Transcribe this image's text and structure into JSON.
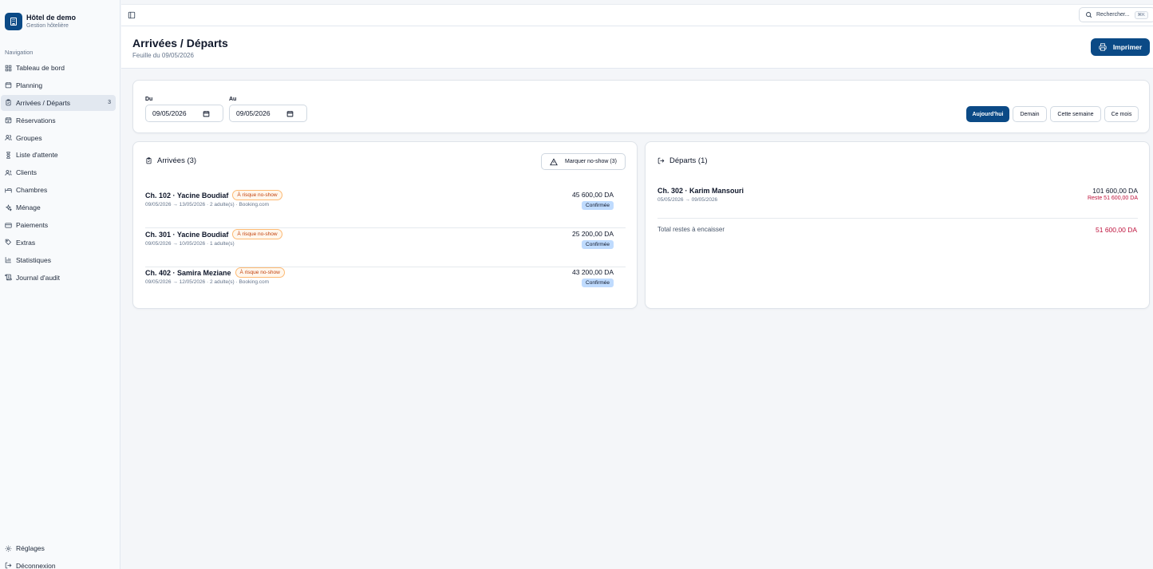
{
  "brand": {
    "name": "Hôtel de demo",
    "subtitle": "Gestion hôtelière"
  },
  "sidebar": {
    "section_label": "Navigation",
    "items": [
      {
        "label": "Tableau de bord",
        "icon": "dashboard-icon"
      },
      {
        "label": "Planning",
        "icon": "calendar-icon"
      },
      {
        "label": "Arrivées / Départs",
        "icon": "clipboard-icon",
        "badge": "3",
        "active": true
      },
      {
        "label": "Réservations",
        "icon": "calendar-check-icon"
      },
      {
        "label": "Groupes",
        "icon": "users-icon"
      },
      {
        "label": "Liste d'attente",
        "icon": "hourglass-icon"
      },
      {
        "label": "Clients",
        "icon": "user-group-icon"
      },
      {
        "label": "Chambres",
        "icon": "bed-icon"
      },
      {
        "label": "Ménage",
        "icon": "sparkles-icon"
      },
      {
        "label": "Paiements",
        "icon": "credit-card-icon"
      },
      {
        "label": "Extras",
        "icon": "tag-icon"
      },
      {
        "label": "Statistiques",
        "icon": "bar-chart-icon"
      },
      {
        "label": "Journal d'audit",
        "icon": "scroll-icon"
      }
    ],
    "bottom": [
      {
        "label": "Réglages",
        "icon": "gear-icon"
      },
      {
        "label": "Déconnexion",
        "icon": "logout-icon"
      }
    ]
  },
  "topbar": {
    "search_label": "Rechercher...",
    "search_shortcut": "⌘K"
  },
  "header": {
    "title": "Arrivées / Départs",
    "subtitle": "Feuille du 09/05/2026",
    "print_label": "Imprimer"
  },
  "filters": {
    "from_label": "Du",
    "from_value": "09/05/2026",
    "to_label": "Au",
    "to_value": "09/05/2026",
    "quick": [
      "Aujourd'hui",
      "Demain",
      "Cette semaine",
      "Ce mois"
    ],
    "active_quick": "Aujourd'hui"
  },
  "arrivals": {
    "title": "Arrivées (3)",
    "noshow_label": "Marquer no-show (3)",
    "rows": [
      {
        "title": "Ch. 102 · Yacine Boudiaf",
        "risk": "À risque no-show",
        "sub": "09/05/2026 → 13/05/2026 · 2 adulte(s) · Booking.com",
        "amount": "45 600,00 DA",
        "status": "Confirmée"
      },
      {
        "title": "Ch. 301 · Yacine Boudiaf",
        "risk": "À risque no-show",
        "sub": "09/05/2026 → 10/05/2026 · 1 adulte(s)",
        "amount": "25 200,00 DA",
        "status": "Confirmée"
      },
      {
        "title": "Ch. 402 · Samira Meziane",
        "risk": "À risque no-show",
        "sub": "09/05/2026 → 12/05/2026 · 2 adulte(s) · Booking.com",
        "amount": "43 200,00 DA",
        "status": "Confirmée"
      }
    ]
  },
  "departures": {
    "title": "Départs (1)",
    "rows": [
      {
        "title": "Ch. 302 · Karim Mansouri",
        "sub": "05/05/2026 → 09/05/2026",
        "amount": "101 600,00 DA",
        "rest": "Reste 51 600,00 DA"
      }
    ],
    "total_label": "Total restes à encaisser",
    "total_value": "51 600,00 DA"
  },
  "colors": {
    "primary": "#0b4a86",
    "danger": "#be123c",
    "warning": "#c2410c",
    "status_bg": "#bfdbfe"
  }
}
